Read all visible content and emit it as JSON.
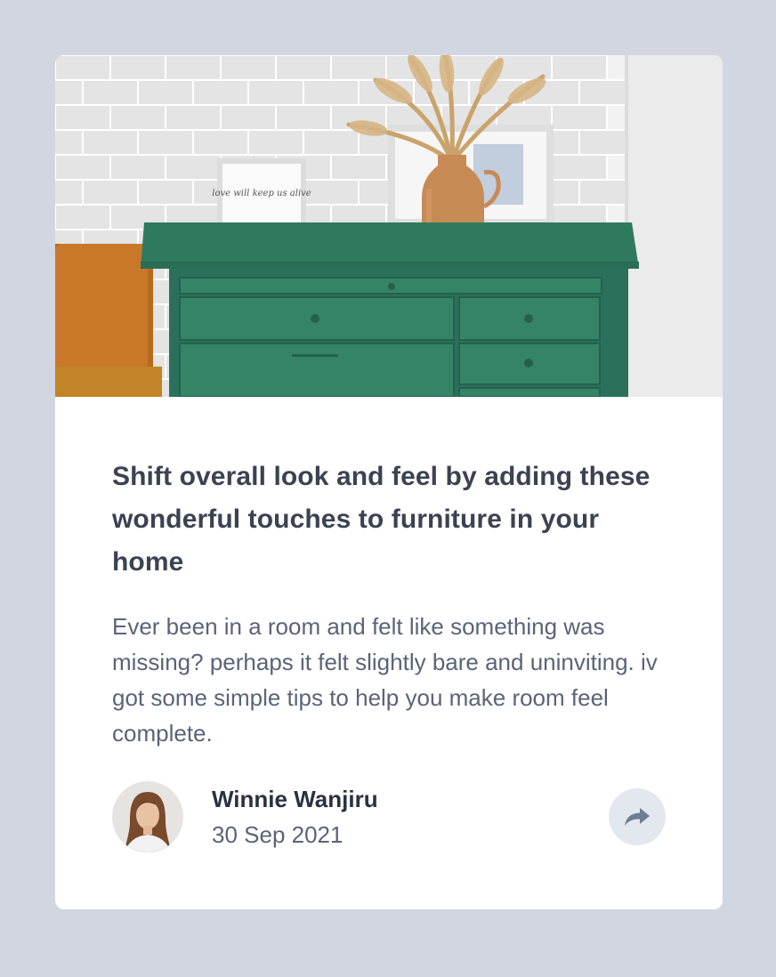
{
  "article": {
    "title": "Shift overall look and feel by adding these wonderful touches to furniture in your home",
    "excerpt": "Ever been in a room and felt like something was missing? perhaps it felt slightly bare and uninviting. iv got some simple tips to help you make room feel complete.",
    "hero_frame_text": "love will keep us alive"
  },
  "author": {
    "name": "Winnie Wanjiru",
    "date": "30 Sep 2021"
  },
  "share": {
    "icon": "share-icon"
  },
  "colors": {
    "page_background": "#d2d6e0",
    "card_background": "#ffffff",
    "headline": "#3b4252",
    "body_text": "#5a6478",
    "share_button_bg": "#e3e7ee",
    "share_icon": "#6e7c96",
    "dresser_green": "#2f7a5e"
  }
}
